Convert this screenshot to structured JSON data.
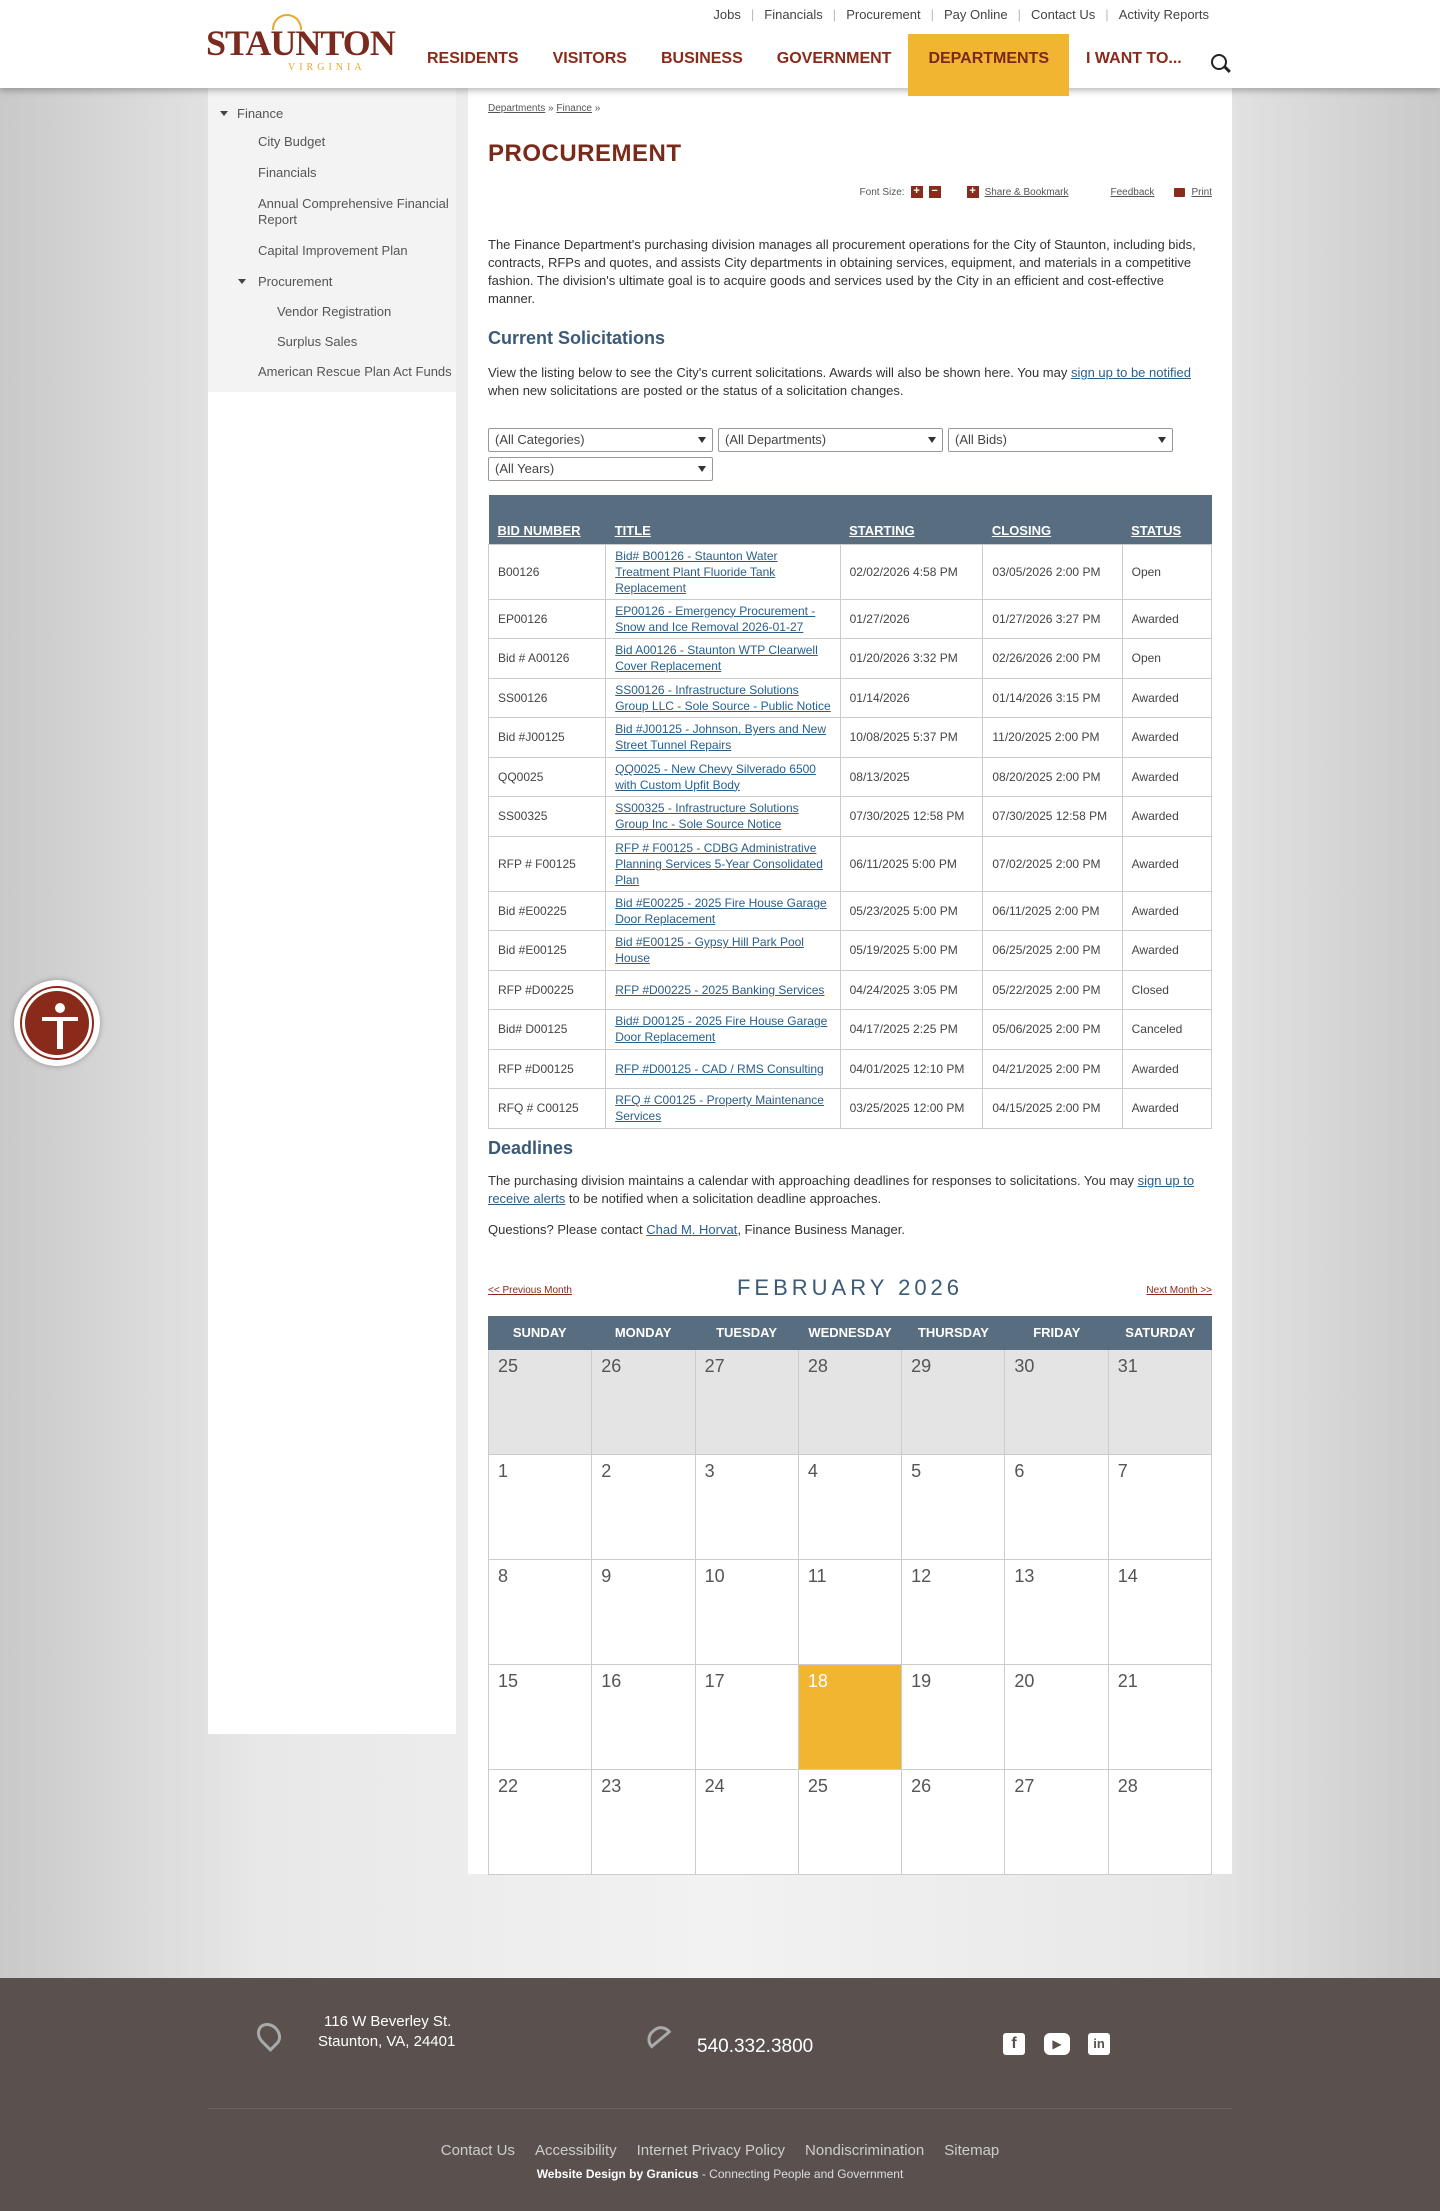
{
  "header": {
    "logo_text": "STAUNTON",
    "logo_sub": "VIRGINIA",
    "utility": [
      "Jobs",
      "Financials",
      "Procurement",
      "Pay Online",
      "Contact Us",
      "Activity Reports"
    ],
    "nav": [
      "RESIDENTS",
      "VISITORS",
      "BUSINESS",
      "GOVERNMENT",
      "DEPARTMENTS",
      "I WANT TO..."
    ],
    "active_nav": "DEPARTMENTS",
    "accent": "#f2b531",
    "brand": "#8a2a1a"
  },
  "sidebar": {
    "top": "Finance",
    "items": [
      "City Budget",
      "Financials",
      "Annual Comprehensive Financial Report",
      "Capital Improvement Plan"
    ],
    "procurement": "Procurement",
    "procurement_children": [
      "Vendor Registration",
      "Surplus Sales"
    ],
    "after": "American Rescue Plan Act Funds"
  },
  "breadcrumb": [
    "Departments",
    "Finance"
  ],
  "page_title": "PROCUREMENT",
  "tools": {
    "font_size": "Font Size:",
    "share": "Share & Bookmark",
    "feedback": "Feedback",
    "print": "Print"
  },
  "intro": "The Finance Department's purchasing division manages all procurement operations for the City of Staunton, including bids, contracts, RFPs and quotes, and assists City departments in obtaining services, equipment, and materials in a competitive fashion. The division's ultimate goal is to acquire goods and services used by the City in an efficient and cost-effective manner.",
  "solicitations": {
    "heading": "Current Solicitations",
    "text_a": "View the listing below to see the City's current solicitations. Awards will also be shown here. You may ",
    "link": "sign up to be notified ",
    "text_b": "when new solicitations are posted or the status of a solicitation changes.",
    "filters": [
      "(All Categories)",
      "(All Departments)",
      "(All Bids)",
      "(All Years)"
    ],
    "headers": [
      "BID NUMBER",
      "TITLE",
      "STARTING",
      "CLOSING",
      "STATUS"
    ],
    "rows": [
      {
        "num": "B00126",
        "title": "Bid# B00126 - Staunton Water Treatment Plant Fluoride Tank Replacement",
        "start": "02/02/2026 4:58 PM",
        "close": "03/05/2026 2:00 PM",
        "status": "Open"
      },
      {
        "num": "EP00126",
        "title": "EP00126 - Emergency Procurement - Snow and Ice Removal 2026-01-27",
        "start": "01/27/2026",
        "close": "01/27/2026 3:27 PM",
        "status": "Awarded"
      },
      {
        "num": "Bid # A00126",
        "title": "Bid A00126 - Staunton WTP Clearwell Cover Replacement",
        "start": "01/20/2026 3:32 PM",
        "close": "02/26/2026 2:00 PM",
        "status": "Open"
      },
      {
        "num": "SS00126",
        "title": "SS00126 - Infrastructure Solutions Group LLC - Sole Source - Public Notice",
        "start": "01/14/2026",
        "close": "01/14/2026 3:15 PM",
        "status": "Awarded"
      },
      {
        "num": "Bid #J00125",
        "title": "Bid #J00125 - Johnson, Byers and New Street Tunnel Repairs",
        "start": "10/08/2025 5:37 PM",
        "close": "11/20/2025 2:00 PM",
        "status": "Awarded"
      },
      {
        "num": "QQ0025",
        "title": "QQ0025 - New Chevy Silverado 6500 with Custom Upfit Body",
        "start": "08/13/2025",
        "close": "08/20/2025 2:00 PM",
        "status": "Awarded"
      },
      {
        "num": "SS00325",
        "title": "SS00325 - Infrastructure Solutions Group Inc - Sole Source Notice",
        "start": "07/30/2025 12:58 PM",
        "close": "07/30/2025 12:58 PM",
        "status": "Awarded"
      },
      {
        "num": "RFP # F00125",
        "title": "RFP # F00125 - CDBG Administrative Planning Services 5-Year Consolidated Plan",
        "start": "06/11/2025 5:00 PM",
        "close": "07/02/2025 2:00 PM",
        "status": "Awarded"
      },
      {
        "num": "Bid #E00225",
        "title": "Bid #E00225 - 2025 Fire House Garage Door Replacement",
        "start": "05/23/2025 5:00 PM",
        "close": "06/11/2025 2:00 PM",
        "status": "Awarded"
      },
      {
        "num": "Bid #E00125",
        "title": "Bid #E00125 - Gypsy Hill Park Pool House",
        "start": "05/19/2025 5:00 PM",
        "close": "06/25/2025 2:00 PM",
        "status": "Awarded"
      },
      {
        "num": "RFP #D00225",
        "title": "RFP #D00225 - 2025 Banking Services",
        "start": "04/24/2025 3:05 PM",
        "close": "05/22/2025 2:00 PM",
        "status": "Closed"
      },
      {
        "num": "Bid# D00125",
        "title": "Bid# D00125 - 2025 Fire House Garage Door Replacement",
        "start": "04/17/2025 2:25 PM",
        "close": "05/06/2025 2:00 PM",
        "status": "Canceled"
      },
      {
        "num": "RFP #D00125",
        "title": "RFP #D00125 - CAD / RMS Consulting",
        "start": "04/01/2025 12:10 PM",
        "close": "04/21/2025 2:00 PM",
        "status": "Awarded"
      },
      {
        "num": "RFQ # C00125",
        "title": "RFQ # C00125 - Property Maintenance Services",
        "start": "03/25/2025 12:00 PM",
        "close": "04/15/2025 2:00 PM",
        "status": "Awarded"
      }
    ]
  },
  "deadlines": {
    "heading": "Deadlines",
    "text_a": "The purchasing division maintains a calendar with approaching deadlines for responses to solicitations. You may ",
    "link": "sign up to receive alerts",
    "text_b": " to be notified when a solicitation deadline approaches.",
    "q_a": "Questions? Please contact ",
    "q_link": "Chad M. Horvat",
    "q_b": ",  Finance Business Manager."
  },
  "calendar": {
    "prev": "<< Previous Month",
    "next": "Next Month >>",
    "title": "FEBRUARY 2026",
    "days": [
      "SUNDAY",
      "MONDAY",
      "TUESDAY",
      "WEDNESDAY",
      "THURSDAY",
      "FRIDAY",
      "SATURDAY"
    ],
    "weeks": [
      [
        "25",
        "26",
        "27",
        "28",
        "29",
        "30",
        "31"
      ],
      [
        "1",
        "2",
        "3",
        "4",
        "5",
        "6",
        "7"
      ],
      [
        "8",
        "9",
        "10",
        "11",
        "12",
        "13",
        "14"
      ],
      [
        "15",
        "16",
        "17",
        "18",
        "19",
        "20",
        "21"
      ],
      [
        "22",
        "23",
        "24",
        "25",
        "26",
        "27",
        "28"
      ]
    ],
    "today": "18"
  },
  "footer": {
    "address1": "116 W Beverley St.",
    "address2": "Staunton, VA, 24401",
    "phone": "540.332.3800",
    "links": [
      "Contact Us",
      "Accessibility",
      "Internet Privacy Policy",
      "Nondiscrimination",
      "Sitemap"
    ],
    "credit_bold": "Website Design by Granicus",
    "credit_rest": " - Connecting People and Government"
  }
}
